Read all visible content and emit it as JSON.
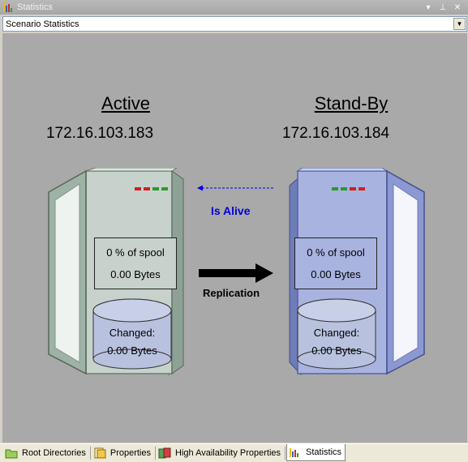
{
  "window": {
    "title": "Statistics"
  },
  "title_controls": {
    "dropdown": "▾",
    "pin": "⊥",
    "close": "✕"
  },
  "scenario_select": {
    "value": "Scenario Statistics"
  },
  "active": {
    "role": "Active",
    "ip": "172.16.103.183",
    "spool_percent": "0 % of spool",
    "spool_bytes": "0.00 Bytes",
    "changed_label": "Changed:",
    "changed_bytes": "0.00 Bytes"
  },
  "standby": {
    "role": "Stand-By",
    "ip": "172.16.103.184",
    "spool_percent": "0 % of spool",
    "spool_bytes": "0.00 Bytes",
    "changed_label": "Changed:",
    "changed_bytes": "0.00 Bytes"
  },
  "links": {
    "is_alive": "Is Alive",
    "replication": "Replication"
  },
  "tabs": [
    {
      "label": "Root Directories",
      "icon": "folder-icon"
    },
    {
      "label": "Properties",
      "icon": "properties-icon"
    },
    {
      "label": "High Availability Properties",
      "icon": "ha-properties-icon"
    },
    {
      "label": "Statistics",
      "icon": "statistics-icon",
      "active": true
    }
  ],
  "colors": {
    "canvas_bg": "#a9a9a9",
    "active_server": "#c7d2cc",
    "standby_server": "#a9b3e0",
    "is_alive": "#0000e0"
  }
}
